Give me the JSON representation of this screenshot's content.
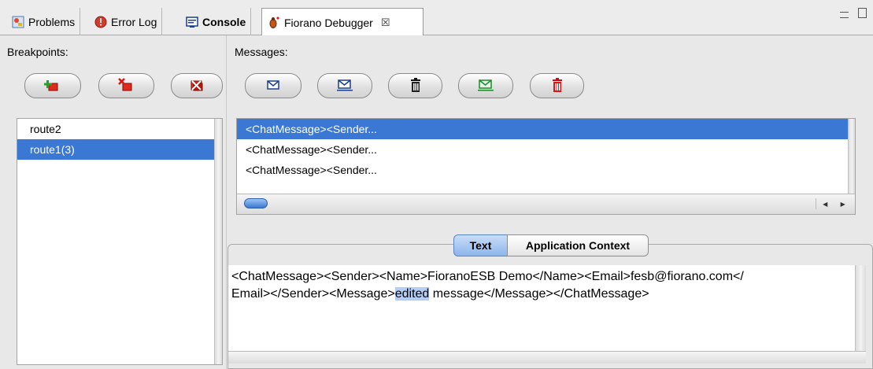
{
  "tabs": [
    {
      "label": "Problems",
      "icon": "problems-icon",
      "bold": false
    },
    {
      "label": "Error Log",
      "icon": "error-log-icon",
      "bold": false
    },
    {
      "label": "Console",
      "icon": "console-icon",
      "bold": true
    },
    {
      "label": "Fiorano Debugger",
      "icon": "debugger-bug-icon",
      "bold": false
    }
  ],
  "tab_close_glyph": "☒",
  "breakpoints": {
    "title": "Breakpoints:",
    "buttons": [
      "add-breakpoint",
      "remove-breakpoint",
      "remove-all-breakpoints"
    ],
    "items": [
      {
        "label": "route2",
        "selected": false
      },
      {
        "label": "route1(3)",
        "selected": true
      }
    ]
  },
  "messages": {
    "title": "Messages:",
    "buttons": [
      "view-message",
      "edit-message",
      "delete-message",
      "send-message",
      "delete-all-messages"
    ],
    "items": [
      {
        "label": "<ChatMessage><Sender...",
        "selected": true
      },
      {
        "label": "<ChatMessage><Sender...",
        "selected": false
      },
      {
        "label": "<ChatMessage><Sender...",
        "selected": false
      }
    ]
  },
  "detail": {
    "tabs": [
      "Text",
      "Application Context"
    ],
    "active_tab": "Text",
    "line1": "<ChatMessage><Sender><Name>FioranoESB Demo</Name><Email>fesb@fiorano.com</",
    "line2_before": "Email></Sender><Message>",
    "line2_highlight": "edited",
    "line2_after": " message</Message></ChatMessage>"
  },
  "colors": {
    "selection": "#3a78d4",
    "text_highlight": "#b3cdf3"
  }
}
